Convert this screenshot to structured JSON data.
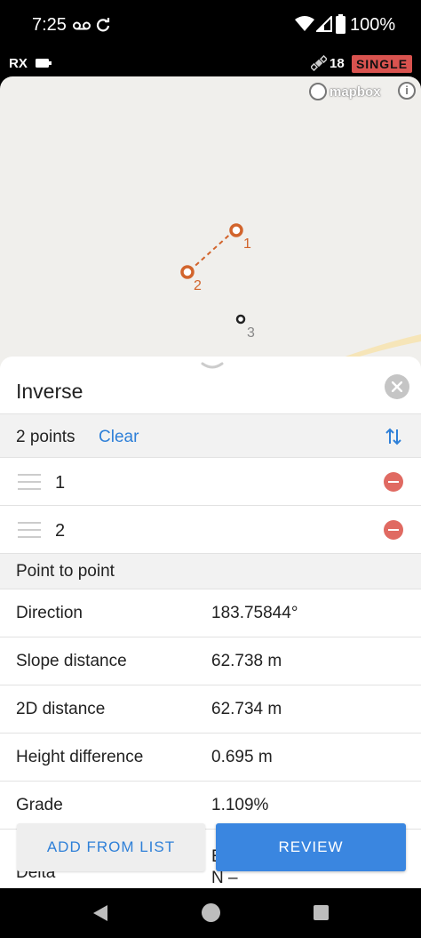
{
  "status_bar": {
    "time": "7:25",
    "battery": "100%",
    "icons": [
      "voicemail-icon",
      "sync-icon",
      "wifi-icon",
      "signal-icon",
      "battery-icon"
    ]
  },
  "receiver": {
    "label": "RX",
    "satellites": "18",
    "fix_status": "SINGLE",
    "fix_color": "#d9534f"
  },
  "map": {
    "attribution": "mapbox",
    "info_symbol": "i",
    "markers": [
      {
        "label": "1",
        "color": "#d2642c",
        "selected": true
      },
      {
        "label": "2",
        "color": "#d2642c",
        "selected": true
      },
      {
        "label": "3",
        "color": "#222222",
        "selected": false
      }
    ]
  },
  "sheet": {
    "title": "Inverse",
    "points_count": "2 points",
    "clear_label": "Clear",
    "points": [
      {
        "label": "1"
      },
      {
        "label": "2"
      }
    ],
    "section_title": "Point to point",
    "results": [
      {
        "label": "Direction",
        "value": "183.75844°"
      },
      {
        "label": "Slope distance",
        "value": "62.738 m"
      },
      {
        "label": "2D distance",
        "value": "62.734 m"
      },
      {
        "label": "Height difference",
        "value": "0.695 m"
      },
      {
        "label": "Grade",
        "value": "1.109%"
      }
    ],
    "partial_row": {
      "label": "Delta",
      "value_line1": "E",
      "value_line2": "N –"
    },
    "add_from_list_label": "ADD FROM LIST",
    "review_label": "REVIEW"
  },
  "colors": {
    "accent": "#2f80d8",
    "primary_button": "#3a86e0",
    "remove": "#e06a62",
    "marker": "#d2642c"
  }
}
